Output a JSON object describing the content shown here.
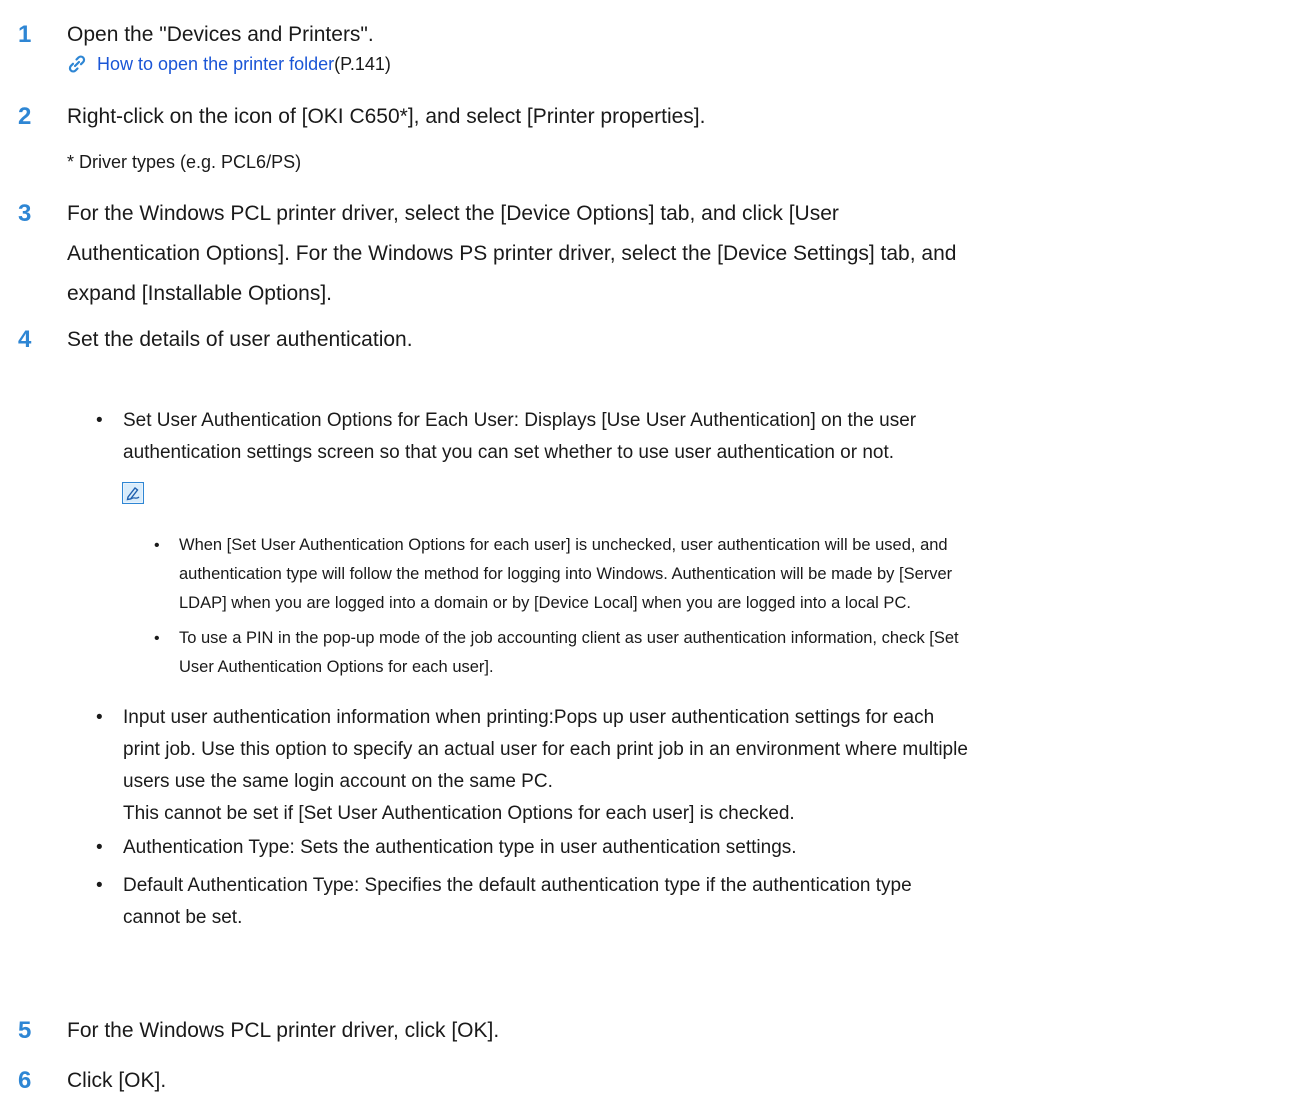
{
  "colors": {
    "step_number": "#2e86d4",
    "link": "#1a55d6",
    "memo_icon": "#2e86d4"
  },
  "steps": [
    {
      "number": "1",
      "text": "Open the \"Devices and Printers\".",
      "link": {
        "icon": "link-chain-icon",
        "text": "How to open the printer folder",
        "page_ref": "(P.141)"
      }
    },
    {
      "number": "2",
      "text": "Right-click on the icon of [OKI C650*], and select [Printer properties].",
      "note": "* Driver types (e.g. PCL6/PS)"
    },
    {
      "number": "3",
      "line1": "For the Windows PCL printer driver, select the [Device Options] tab, and click [User",
      "line2": "Authentication Options]. For the Windows PS printer driver, select the [Device Settings] tab, and",
      "line3": "expand [Installable Options]."
    },
    {
      "number": "4",
      "text": "Set the details of user authentication.",
      "bullets": [
        {
          "line1": "Set User Authentication Options for Each User: Displays [Use User Authentication] on the user",
          "line2": "authentication settings screen so that you can set whether to use user authentication or not.",
          "memo_icon": "memo-pencil-icon",
          "memo_items": [
            {
              "line1": "When [Set User Authentication Options for each user] is unchecked, user authentication will be used, and",
              "line2": "authentication type will follow the method for logging into Windows. Authentication will be made by [Server",
              "line3": "LDAP] when you are logged into a domain or by [Device Local] when you are logged into a local PC."
            },
            {
              "line1": "To use a PIN in the pop-up mode of the job accounting client as user authentication information, check [Set",
              "line2": "User Authentication Options for each user]."
            }
          ]
        },
        {
          "line1": "Input user authentication information when printing:Pops up user authentication settings for each",
          "line2": "print job. Use this option to specify an actual user for each print job in an environment where multiple",
          "line3": "users use the same login account on the same PC.",
          "line4": "This cannot be set if [Set User Authentication Options for each user] is checked."
        },
        {
          "line1": "Authentication Type: Sets the authentication type in user authentication settings."
        },
        {
          "line1": "Default Authentication Type: Specifies the default authentication type if the authentication type",
          "line2": "cannot be set."
        }
      ],
      "bullet_char": "•"
    },
    {
      "number": "5",
      "text": "For the Windows PCL printer driver, click [OK]."
    },
    {
      "number": "6",
      "text": "Click [OK]."
    }
  ]
}
